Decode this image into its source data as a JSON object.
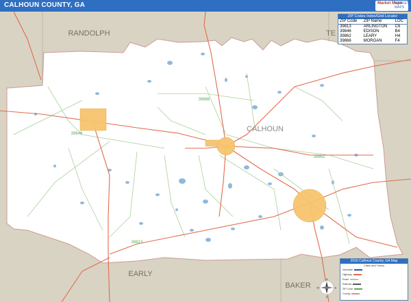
{
  "header": {
    "title": "CALHOUN COUNTY, GA"
  },
  "logo": {
    "line1": "Market Maps",
    "line2": "MARKET MAPS"
  },
  "map": {
    "county_label": "CALHOUN",
    "neighbors": {
      "north": "RANDOLPH",
      "north_east": "TE",
      "south_west": "EARLY",
      "south_east": "BAKER"
    },
    "zip_labels": {
      "z1": "39866",
      "z2": "39846",
      "z3": "39862",
      "z4": "39813"
    },
    "colors": {
      "land": "#ffffff",
      "outside": "#d9d3c4",
      "county_border": "#ce9a8f",
      "highway": "#e06a4a",
      "minor_road": "#a8cf9c",
      "water": "#8fb8dc",
      "city": "#f7c56e",
      "title_bar": "#2f6fc1"
    }
  },
  "zip_table": {
    "title": "ZIP Codes Index/Grid Locator",
    "headers": [
      "ZIP Code",
      "ZIP Name",
      "LOC"
    ],
    "rows": [
      {
        "zip": "39813",
        "name": "ARLINGTON",
        "loc": "C6"
      },
      {
        "zip": "39846",
        "name": "EDISON",
        "loc": "B4"
      },
      {
        "zip": "39862",
        "name": "LEARY",
        "loc": "H4"
      },
      {
        "zip": "39866",
        "name": "MORGAN",
        "loc": "F4"
      }
    ]
  },
  "legend": {
    "title": "2016 Calhoun County, GA Map",
    "subtitle": "Cities and Towns",
    "items": [
      "Interstate",
      "Highway",
      "Road",
      "Railroad",
      "ZIP Code",
      "County"
    ]
  },
  "compass": {
    "north": "N",
    "south": "S",
    "east": "E",
    "west": "W"
  }
}
